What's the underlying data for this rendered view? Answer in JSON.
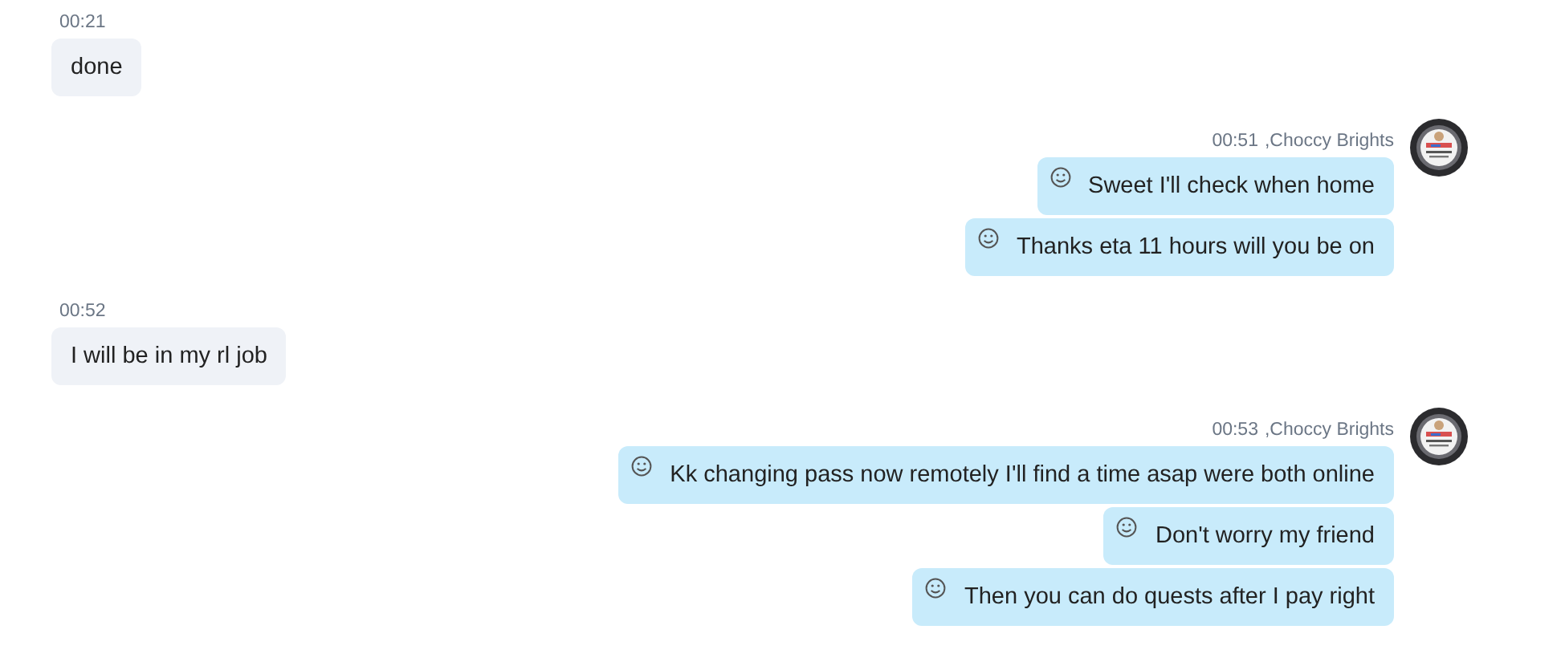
{
  "groups": [
    {
      "kind": "incoming",
      "time": "00:21",
      "messages": [
        {
          "text": "done"
        }
      ]
    },
    {
      "kind": "outgoing",
      "time": "00:51",
      "sender": ",Choccy Brights",
      "messages": [
        {
          "text": "Sweet I'll check when home"
        },
        {
          "text": "Thanks eta 11 hours will you be on"
        }
      ]
    },
    {
      "kind": "incoming",
      "time": "00:52",
      "messages": [
        {
          "text": "I will be in my rl job"
        }
      ]
    },
    {
      "kind": "outgoing",
      "time": "00:53",
      "sender": ",Choccy Brights",
      "messages": [
        {
          "text": "Kk changing pass now remotely I'll find a time asap were both online"
        },
        {
          "text": "Don't worry my friend"
        },
        {
          "text": "Then you can do quests after I pay right"
        }
      ]
    }
  ]
}
